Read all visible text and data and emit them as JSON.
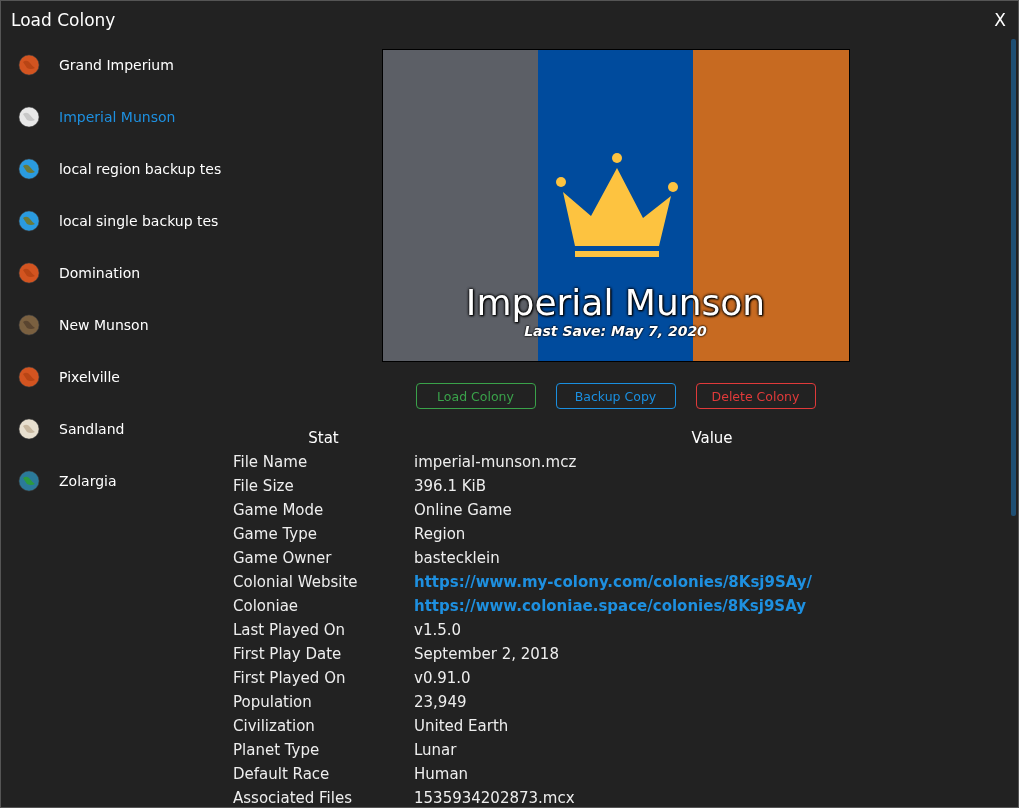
{
  "window": {
    "title": "Load Colony",
    "close": "X"
  },
  "colonies": [
    {
      "name": "Grand Imperium",
      "kind": "mars",
      "selected": false
    },
    {
      "name": "Imperial Munson",
      "kind": "moon",
      "selected": true
    },
    {
      "name": "local region backup tes",
      "kind": "earth",
      "selected": false
    },
    {
      "name": "local single backup tes",
      "kind": "earth",
      "selected": false
    },
    {
      "name": "Domination",
      "kind": "mars",
      "selected": false
    },
    {
      "name": "New Munson",
      "kind": "rock",
      "selected": false
    },
    {
      "name": "Pixelville",
      "kind": "mars",
      "selected": false
    },
    {
      "name": "Sandland",
      "kind": "sand",
      "selected": false
    },
    {
      "name": "Zolargia",
      "kind": "ocean",
      "selected": false
    }
  ],
  "preview": {
    "title": "Imperial Munson",
    "last_save": "Last Save: May 7, 2020"
  },
  "buttons": [
    {
      "label": "Load Colony",
      "kind": "load"
    },
    {
      "label": "Backup Copy",
      "kind": "backup"
    },
    {
      "label": "Delete Colony",
      "kind": "delete"
    }
  ],
  "table": {
    "columns": [
      "Stat",
      "Value"
    ],
    "rows": [
      {
        "stat": "File Name",
        "value": "imperial-munson.mcz",
        "kind": "text"
      },
      {
        "stat": "File Size",
        "value": "396.1 KiB",
        "kind": "text"
      },
      {
        "stat": "Game Mode",
        "value": "Online Game",
        "kind": "text"
      },
      {
        "stat": "Game Type",
        "value": "Region",
        "kind": "text"
      },
      {
        "stat": "Game Owner",
        "value": "bastecklein",
        "kind": "text"
      },
      {
        "stat": "Colonial Website",
        "value": "https://www.my-colony.com/colonies/8Ksj9SAy/",
        "kind": "link"
      },
      {
        "stat": "Coloniae",
        "value": "https://www.coloniae.space/colonies/8Ksj9SAy",
        "kind": "link"
      },
      {
        "stat": "Last Played On",
        "value": "v1.5.0",
        "kind": "text"
      },
      {
        "stat": "First Play Date",
        "value": "September 2, 2018",
        "kind": "text"
      },
      {
        "stat": "First Played On",
        "value": "v0.91.0",
        "kind": "text"
      },
      {
        "stat": "Population",
        "value": "23,949",
        "kind": "text"
      },
      {
        "stat": "Civilization",
        "value": "United Earth",
        "kind": "text"
      },
      {
        "stat": "Planet Type",
        "value": "Lunar",
        "kind": "text"
      },
      {
        "stat": "Default Race",
        "value": "Human",
        "kind": "text"
      },
      {
        "stat": "Associated Files",
        "value": "1535934202873.mcx",
        "kind": "text"
      }
    ]
  }
}
